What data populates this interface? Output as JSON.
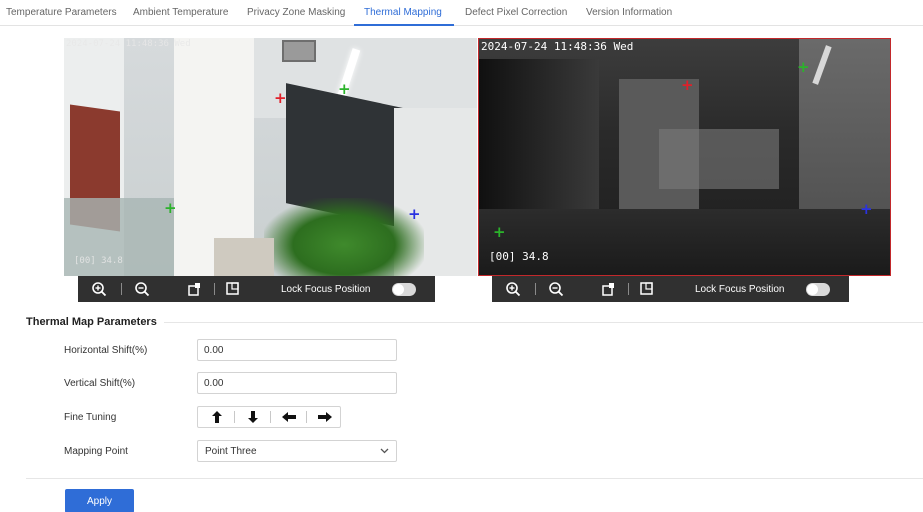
{
  "tabs": [
    {
      "label": "Temperature Parameters",
      "active": false
    },
    {
      "label": "Ambient Temperature",
      "active": false
    },
    {
      "label": "Privacy Zone Masking",
      "active": false
    },
    {
      "label": "Thermal Mapping",
      "active": true
    },
    {
      "label": "Defect Pixel Correction",
      "active": false
    },
    {
      "label": "Version Information",
      "active": false
    }
  ],
  "video_left": {
    "timestamp": "2024-07-24 11:48:36 Wed",
    "reading": "[00] 34.8"
  },
  "video_right": {
    "timestamp": "2024-07-24 11:48:36 Wed",
    "reading": "[00] 34.8"
  },
  "video_toolbar": {
    "icons": [
      "zoom-in-icon",
      "zoom-out-icon",
      "focus-near-icon",
      "focus-far-icon"
    ],
    "lock_focus_label": "Lock Focus Position",
    "lock_focus_enabled": false
  },
  "thermal_map": {
    "section_title": "Thermal Map Parameters",
    "horizontal_shift_label": "Horizontal Shift(%)",
    "horizontal_shift_value": "0.00",
    "vertical_shift_label": "Vertical Shift(%)",
    "vertical_shift_value": "0.00",
    "fine_tuning_label": "Fine Tuning",
    "fine_tuning_icons": [
      "arrow-up-icon",
      "arrow-down-icon",
      "arrow-left-icon",
      "arrow-right-icon"
    ],
    "mapping_point_label": "Mapping Point",
    "mapping_point_value": "Point Three"
  },
  "apply_label": "Apply",
  "colors": {
    "accent": "#2f6dd7",
    "active_video_border": "#c2282b",
    "toolbar_bg": "#303030",
    "marker_red": "#e0202a",
    "marker_green": "#2bb32b",
    "marker_blue": "#2a32e0"
  }
}
